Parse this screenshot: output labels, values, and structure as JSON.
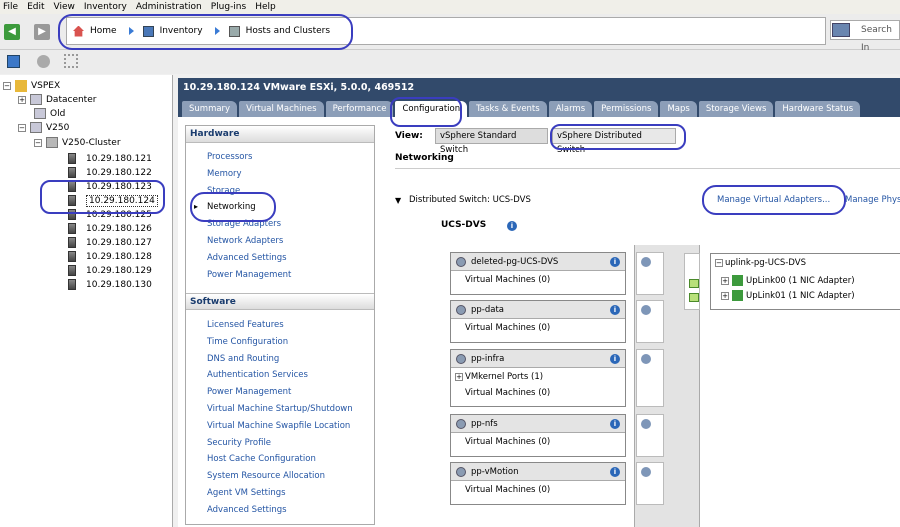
{
  "menu": [
    "File",
    "Edit",
    "View",
    "Inventory",
    "Administration",
    "Plug-ins",
    "Help"
  ],
  "breadcrumb": [
    "Home",
    "Inventory",
    "Hosts and Clusters"
  ],
  "search_placeholder": "Search In",
  "tree": {
    "root": "VSPEX",
    "datacenter": "Datacenter",
    "old": "Old",
    "v250": "V250",
    "cluster": "V250-Cluster",
    "hosts": [
      "10.29.180.121",
      "10.29.180.122",
      "10.29.180.123",
      "10.29.180.124",
      "10.29.180.125",
      "10.29.180.126",
      "10.29.180.127",
      "10.29.180.128",
      "10.29.180.129",
      "10.29.180.130"
    ]
  },
  "header": "10.29.180.124 VMware ESXi, 5.0.0, 469512",
  "tabs": [
    "Summary",
    "Virtual Machines",
    "Performance",
    "Configuration",
    "Tasks & Events",
    "Alarms",
    "Permissions",
    "Maps",
    "Storage Views",
    "Hardware Status"
  ],
  "hardware": {
    "title": "Hardware",
    "items": [
      "Processors",
      "Memory",
      "Storage",
      "Networking",
      "Storage Adapters",
      "Network Adapters",
      "Advanced Settings",
      "Power Management"
    ]
  },
  "software": {
    "title": "Software",
    "items": [
      "Licensed Features",
      "Time Configuration",
      "DNS and Routing",
      "Authentication Services",
      "Power Management",
      "Virtual Machine Startup/Shutdown",
      "Virtual Machine Swapfile Location",
      "Security Profile",
      "Host Cache Configuration",
      "System Resource Allocation",
      "Agent VM Settings",
      "Advanced Settings"
    ]
  },
  "view": {
    "label": "View:",
    "standard": "vSphere Standard Switch",
    "distributed": "vSphere Distributed Switch"
  },
  "networking": "Networking",
  "dswitch": {
    "label": "Distributed Switch: UCS-DVS",
    "manage_virtual": "Manage Virtual Adapters...",
    "manage_phys": "Manage Phys",
    "name": "UCS-DVS"
  },
  "portgroups": [
    {
      "name": "deleted-pg-UCS-DVS",
      "rows": [
        "Virtual Machines (0)"
      ]
    },
    {
      "name": "pp-data",
      "rows": [
        "Virtual Machines (0)"
      ]
    },
    {
      "name": "pp-infra",
      "rows": [
        "VMkernel Ports (1)",
        "Virtual Machines (0)"
      ]
    },
    {
      "name": "pp-nfs",
      "rows": [
        "Virtual Machines (0)"
      ]
    },
    {
      "name": "pp-vMotion",
      "rows": [
        "Virtual Machines (0)"
      ]
    }
  ],
  "uplink": {
    "name": "uplink-pg-UCS-DVS",
    "items": [
      "UpLink00 (1 NIC Adapter)",
      "UpLink01 (1 NIC Adapter)"
    ]
  }
}
